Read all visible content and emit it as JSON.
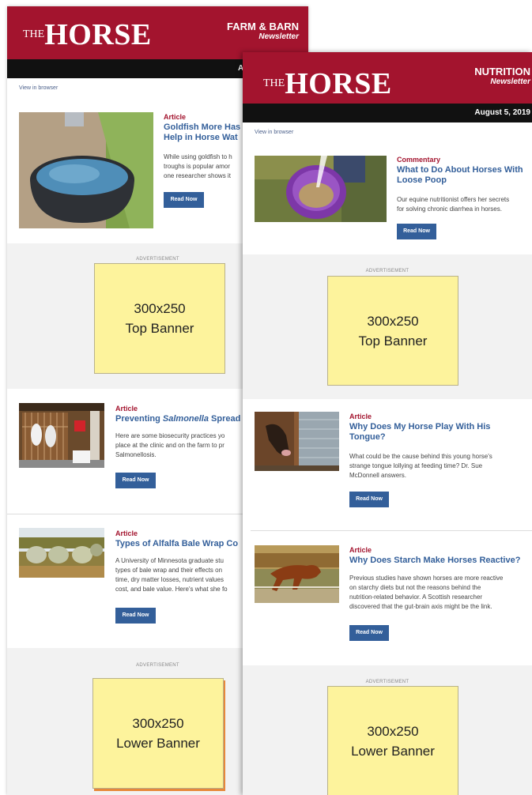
{
  "newsletter1": {
    "logo_the": "THE",
    "logo_main": "HORSE",
    "section_title": "FARM & BARN",
    "section_subtitle": "Newsletter",
    "date_partial": "A",
    "view_in_browser": "View in browser",
    "articles": [
      {
        "category": "Article",
        "title_l1": "Goldfish More Has",
        "title_l2": "Help in Horse Wat",
        "desc_l1": "While using goldfish to h",
        "desc_l2": "troughs is popular amor",
        "desc_l3": "one researcher shows it",
        "button": "Read Now"
      },
      {
        "category": "Article",
        "title_pre": "Preventing ",
        "title_em": "Salmonella",
        "title_post": " Spread",
        "desc_l1": "Here are some biosecurity practices yo",
        "desc_l2": "place at the clinic and on the farm to pr",
        "desc_l3": "Salmonellosis.",
        "button": "Read Now"
      },
      {
        "category": "Article",
        "title_l1": "Types of Alfalfa Bale Wrap Co",
        "desc_l1": "A University of Minnesota graduate stu",
        "desc_l2": "types of bale wrap and their effects on",
        "desc_l3": "time, dry matter losses, nutrient values",
        "desc_l4": "cost, and bale value. Here's what she fo",
        "button": "Read Now"
      }
    ],
    "ad_label": "ADVERTISEMENT",
    "top_banner": {
      "size": "300x250",
      "name": "Top Banner"
    },
    "lower_banner": {
      "size": "300x250",
      "name": "Lower Banner"
    }
  },
  "newsletter2": {
    "logo_the": "THE",
    "logo_main": "HORSE",
    "section_title": "NUTRITION",
    "section_subtitle": "Newsletter",
    "date": "August 5, 2019",
    "view_in_browser": "View in browser",
    "articles": [
      {
        "category": "Commentary",
        "title_l1": "What to Do About Horses With",
        "title_l2": "Loose Poop",
        "desc_l1": "Our equine nutritionist offers her secrets",
        "desc_l2": "for solving chronic diarrhea in horses.",
        "button": "Read Now"
      },
      {
        "category": "Article",
        "title_l1": "Why Does My Horse Play With His",
        "title_l2": "Tongue?",
        "desc_l1": "What could be the cause behind this young horse's",
        "desc_l2": "strange tongue lollying at feeding time? Dr. Sue",
        "desc_l3": "McDonnell answers.",
        "button": "Read Now"
      },
      {
        "category": "Article",
        "title_l1": "Why Does Starch Make Horses Reactive?",
        "desc_l1": "Previous studies have shown horses are more reactive",
        "desc_l2": "on starchy diets but not the reasons behind the",
        "desc_l3": "nutrition-related behavior. A Scottish researcher",
        "desc_l4": "discovered that the gut-brain axis might be the link.",
        "button": "Read Now"
      }
    ],
    "ad_label": "ADVERTISEMENT",
    "top_banner": {
      "size": "300x250",
      "name": "Top Banner"
    },
    "lower_banner": {
      "size": "300x250",
      "name": "Lower Banner"
    }
  },
  "colors": {
    "brand_red": "#a3142e",
    "link_blue": "#335f9a",
    "ad_yellow": "#fdf39c",
    "header_black": "#111111"
  }
}
